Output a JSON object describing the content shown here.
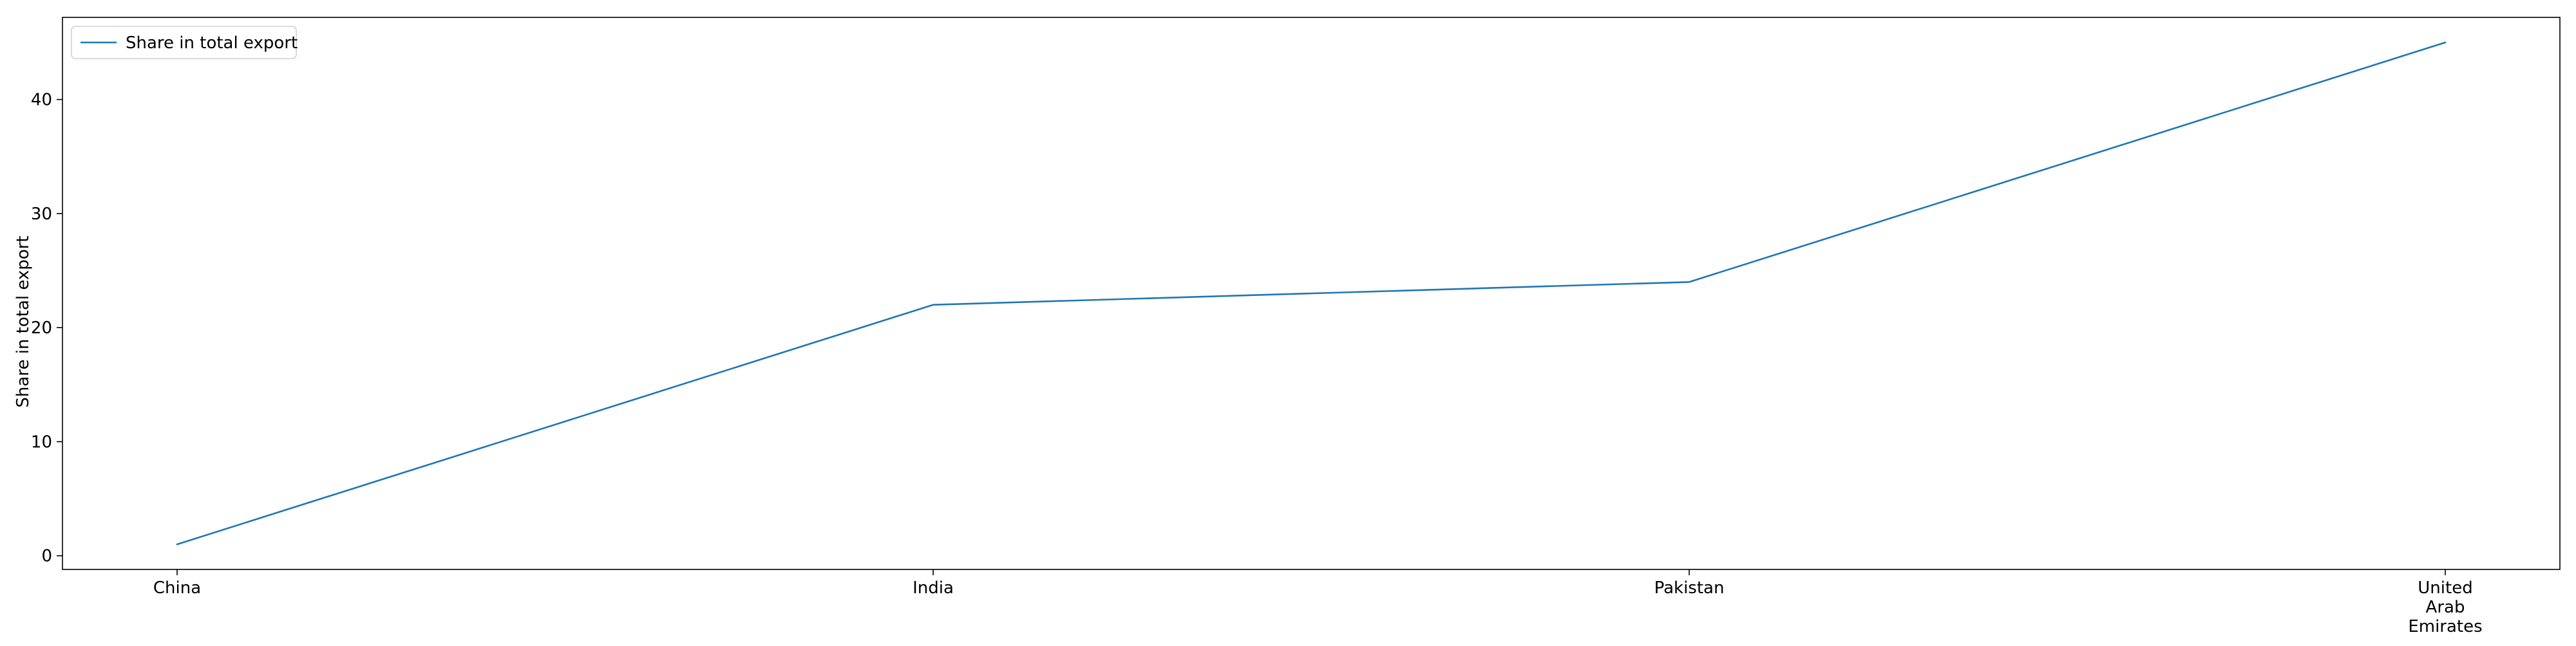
{
  "chart_data": {
    "type": "line",
    "categories": [
      "China",
      "India",
      "Pakistan",
      "United\nArab\nEmirates"
    ],
    "series": [
      {
        "name": "Share in total export",
        "values": [
          1,
          22,
          24,
          45
        ],
        "color": "#1f77b4"
      }
    ],
    "title": "",
    "xlabel": "",
    "ylabel": "Share in total export",
    "ylim": [
      -1.2,
      47.2
    ],
    "yticks": [
      0,
      10,
      20,
      30,
      40
    ],
    "grid": false,
    "legend_position": "top-left"
  }
}
